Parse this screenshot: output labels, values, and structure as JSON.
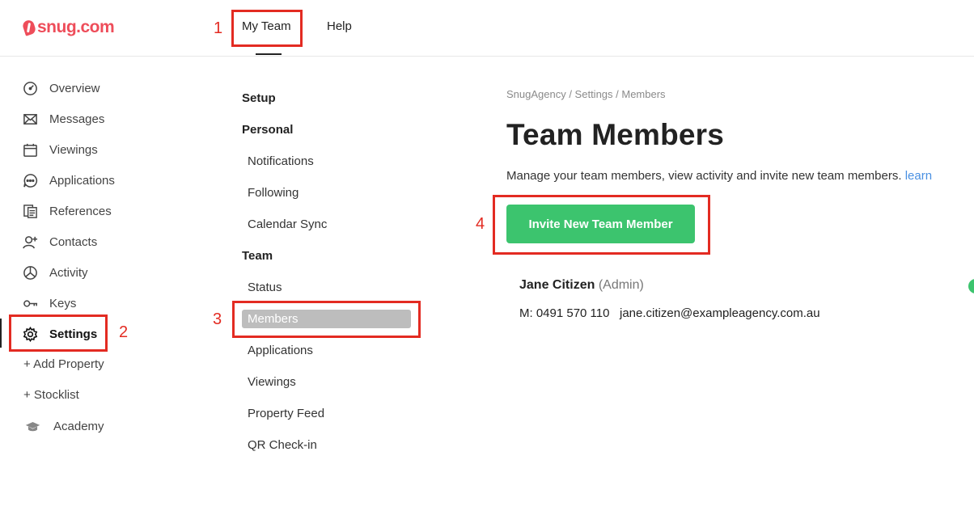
{
  "brand": {
    "logo_text": "snug.com",
    "color": "#ee4d5a"
  },
  "top_nav": {
    "tabs": [
      {
        "label": "My Team",
        "active": true
      },
      {
        "label": "Help",
        "active": false
      }
    ]
  },
  "annotations": {
    "markers": [
      "1",
      "2",
      "3",
      "4"
    ],
    "color": "#e32b22"
  },
  "sidebar": {
    "items": [
      {
        "label": "Overview",
        "icon": "dashboard-gauge-icon"
      },
      {
        "label": "Messages",
        "icon": "envelope-icon"
      },
      {
        "label": "Viewings",
        "icon": "calendar-icon"
      },
      {
        "label": "Applications",
        "icon": "chat-bubble-icon"
      },
      {
        "label": "References",
        "icon": "documents-icon"
      },
      {
        "label": "Contacts",
        "icon": "add-user-icon"
      },
      {
        "label": "Activity",
        "icon": "pie-chart-icon"
      },
      {
        "label": "Keys",
        "icon": "key-icon"
      },
      {
        "label": "Settings",
        "icon": "gear-icon",
        "active": true
      }
    ],
    "add_property": "+ Add Property",
    "stocklist": "+ Stocklist",
    "academy": {
      "label": "Academy",
      "icon": "graduation-cap-icon"
    }
  },
  "settings_nav": {
    "setup": "Setup",
    "personal": "Personal",
    "personal_items": [
      "Notifications",
      "Following",
      "Calendar Sync"
    ],
    "team": "Team",
    "team_items": [
      "Status",
      "Members",
      "Applications",
      "Viewings",
      "Property Feed",
      "QR Check-in"
    ],
    "active_item": "Members"
  },
  "main": {
    "breadcrumb": "SnugAgency / Settings / Members",
    "title": "Team Members",
    "description": "Manage your team members, view activity and invite new team members.",
    "description_link": "learn",
    "invite_button": "Invite New Team Member",
    "button_color": "#3cc46e"
  },
  "member": {
    "name": "Jane Citizen",
    "role": "(Admin)",
    "mobile": "M: 0491 570 110",
    "email": "jane.citizen@exampleagency.com.au",
    "status_color": "#3cc46e"
  }
}
